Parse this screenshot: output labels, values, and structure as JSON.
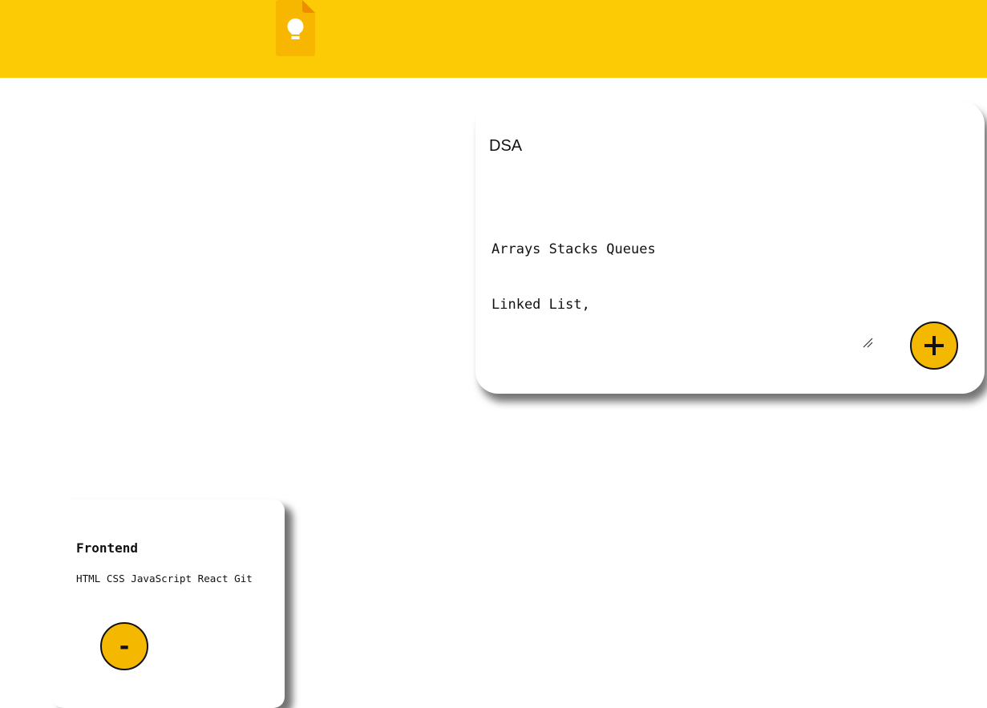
{
  "header": {
    "logo_icon": "keep-lightbulb-icon",
    "color": "#fccb06"
  },
  "create_note": {
    "title_value": "DSA",
    "content_lines": [
      "Arrays Stacks Queues",
      "Linked List,"
    ],
    "add_button_icon": "plus-icon",
    "add_button_label": "+"
  },
  "notes": [
    {
      "title": "Frontend",
      "content": "HTML CSS JavaScript React Git",
      "delete_label": "-"
    }
  ],
  "colors": {
    "accent": "#f5b800",
    "header": "#fccb06"
  }
}
